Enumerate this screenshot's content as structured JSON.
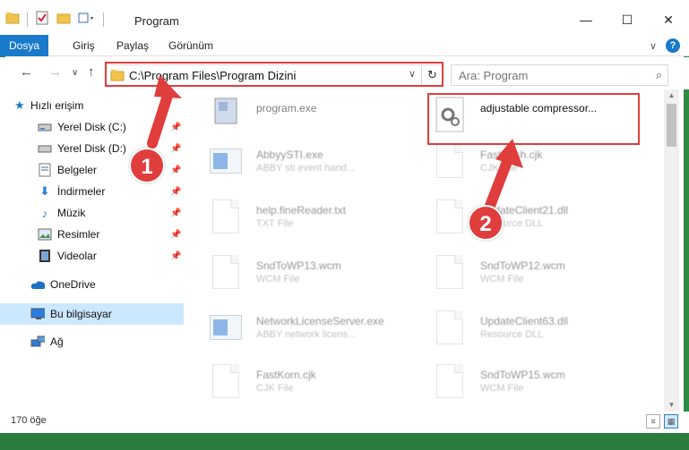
{
  "window": {
    "title": "Program",
    "minimize": "—",
    "maximize": "☐",
    "close": "✕"
  },
  "ribbon": {
    "tabs": [
      "Dosya",
      "Giriş",
      "Paylaş",
      "Görünüm"
    ],
    "collapse": "∨",
    "help": "?"
  },
  "nav": {
    "back": "←",
    "forward": "→",
    "recent": "∨",
    "up": "↑",
    "address": "C:\\Program Files\\Program Dizini",
    "dropdown": "∨",
    "refresh": "↻",
    "search_placeholder": "Ara: Program",
    "search_icon": "⌕"
  },
  "sidebar": {
    "items": [
      {
        "label": "Hızlı erişim",
        "icon": "star-icon"
      },
      {
        "label": "Yerel Disk (C:)",
        "icon": "drive-icon"
      },
      {
        "label": "Yerel Disk (D:)",
        "icon": "drive-icon"
      },
      {
        "label": "Belgeler",
        "icon": "documents-icon"
      },
      {
        "label": "İndirmeler",
        "icon": "download-icon"
      },
      {
        "label": "Müzik",
        "icon": "music-icon"
      },
      {
        "label": "Resimler",
        "icon": "pictures-icon"
      },
      {
        "label": "Videolar",
        "icon": "video-icon"
      },
      {
        "label": "OneDrive",
        "icon": "cloud-icon"
      },
      {
        "label": "Bu bilgisayar",
        "icon": "computer-icon"
      },
      {
        "label": "Ağ",
        "icon": "network-icon"
      }
    ]
  },
  "files": [
    {
      "name": "program.exe",
      "type": ""
    },
    {
      "name": "adjustable compressor...",
      "type": ""
    },
    {
      "name": "AbbyySTI.exe",
      "type": "ABBY sti event hand..."
    },
    {
      "name": "FastHash.cjk",
      "type": "CJK File"
    },
    {
      "name": "help.fineReader.txt",
      "type": "TXT File"
    },
    {
      "name": "UpdateClient21.dll",
      "type": "Resource DLL"
    },
    {
      "name": "SndToWP13.wcm",
      "type": "WCM File"
    },
    {
      "name": "SndToWP12.wcm",
      "type": "WCM File"
    },
    {
      "name": "NetworkLicenseServer.exe",
      "type": "ABBY network licens..."
    },
    {
      "name": "UpdateClient63.dll",
      "type": "Resource DLL"
    },
    {
      "name": "FastKorn.cjk",
      "type": "CJK File"
    },
    {
      "name": "SndToWP15.wcm",
      "type": "WCM File"
    }
  ],
  "status": {
    "count": "170 öğe"
  },
  "callouts": [
    "1",
    "2"
  ],
  "colors": {
    "accent": "#1979ca",
    "highlight": "#e03d3d",
    "selected_bg": "#cce8ff"
  }
}
